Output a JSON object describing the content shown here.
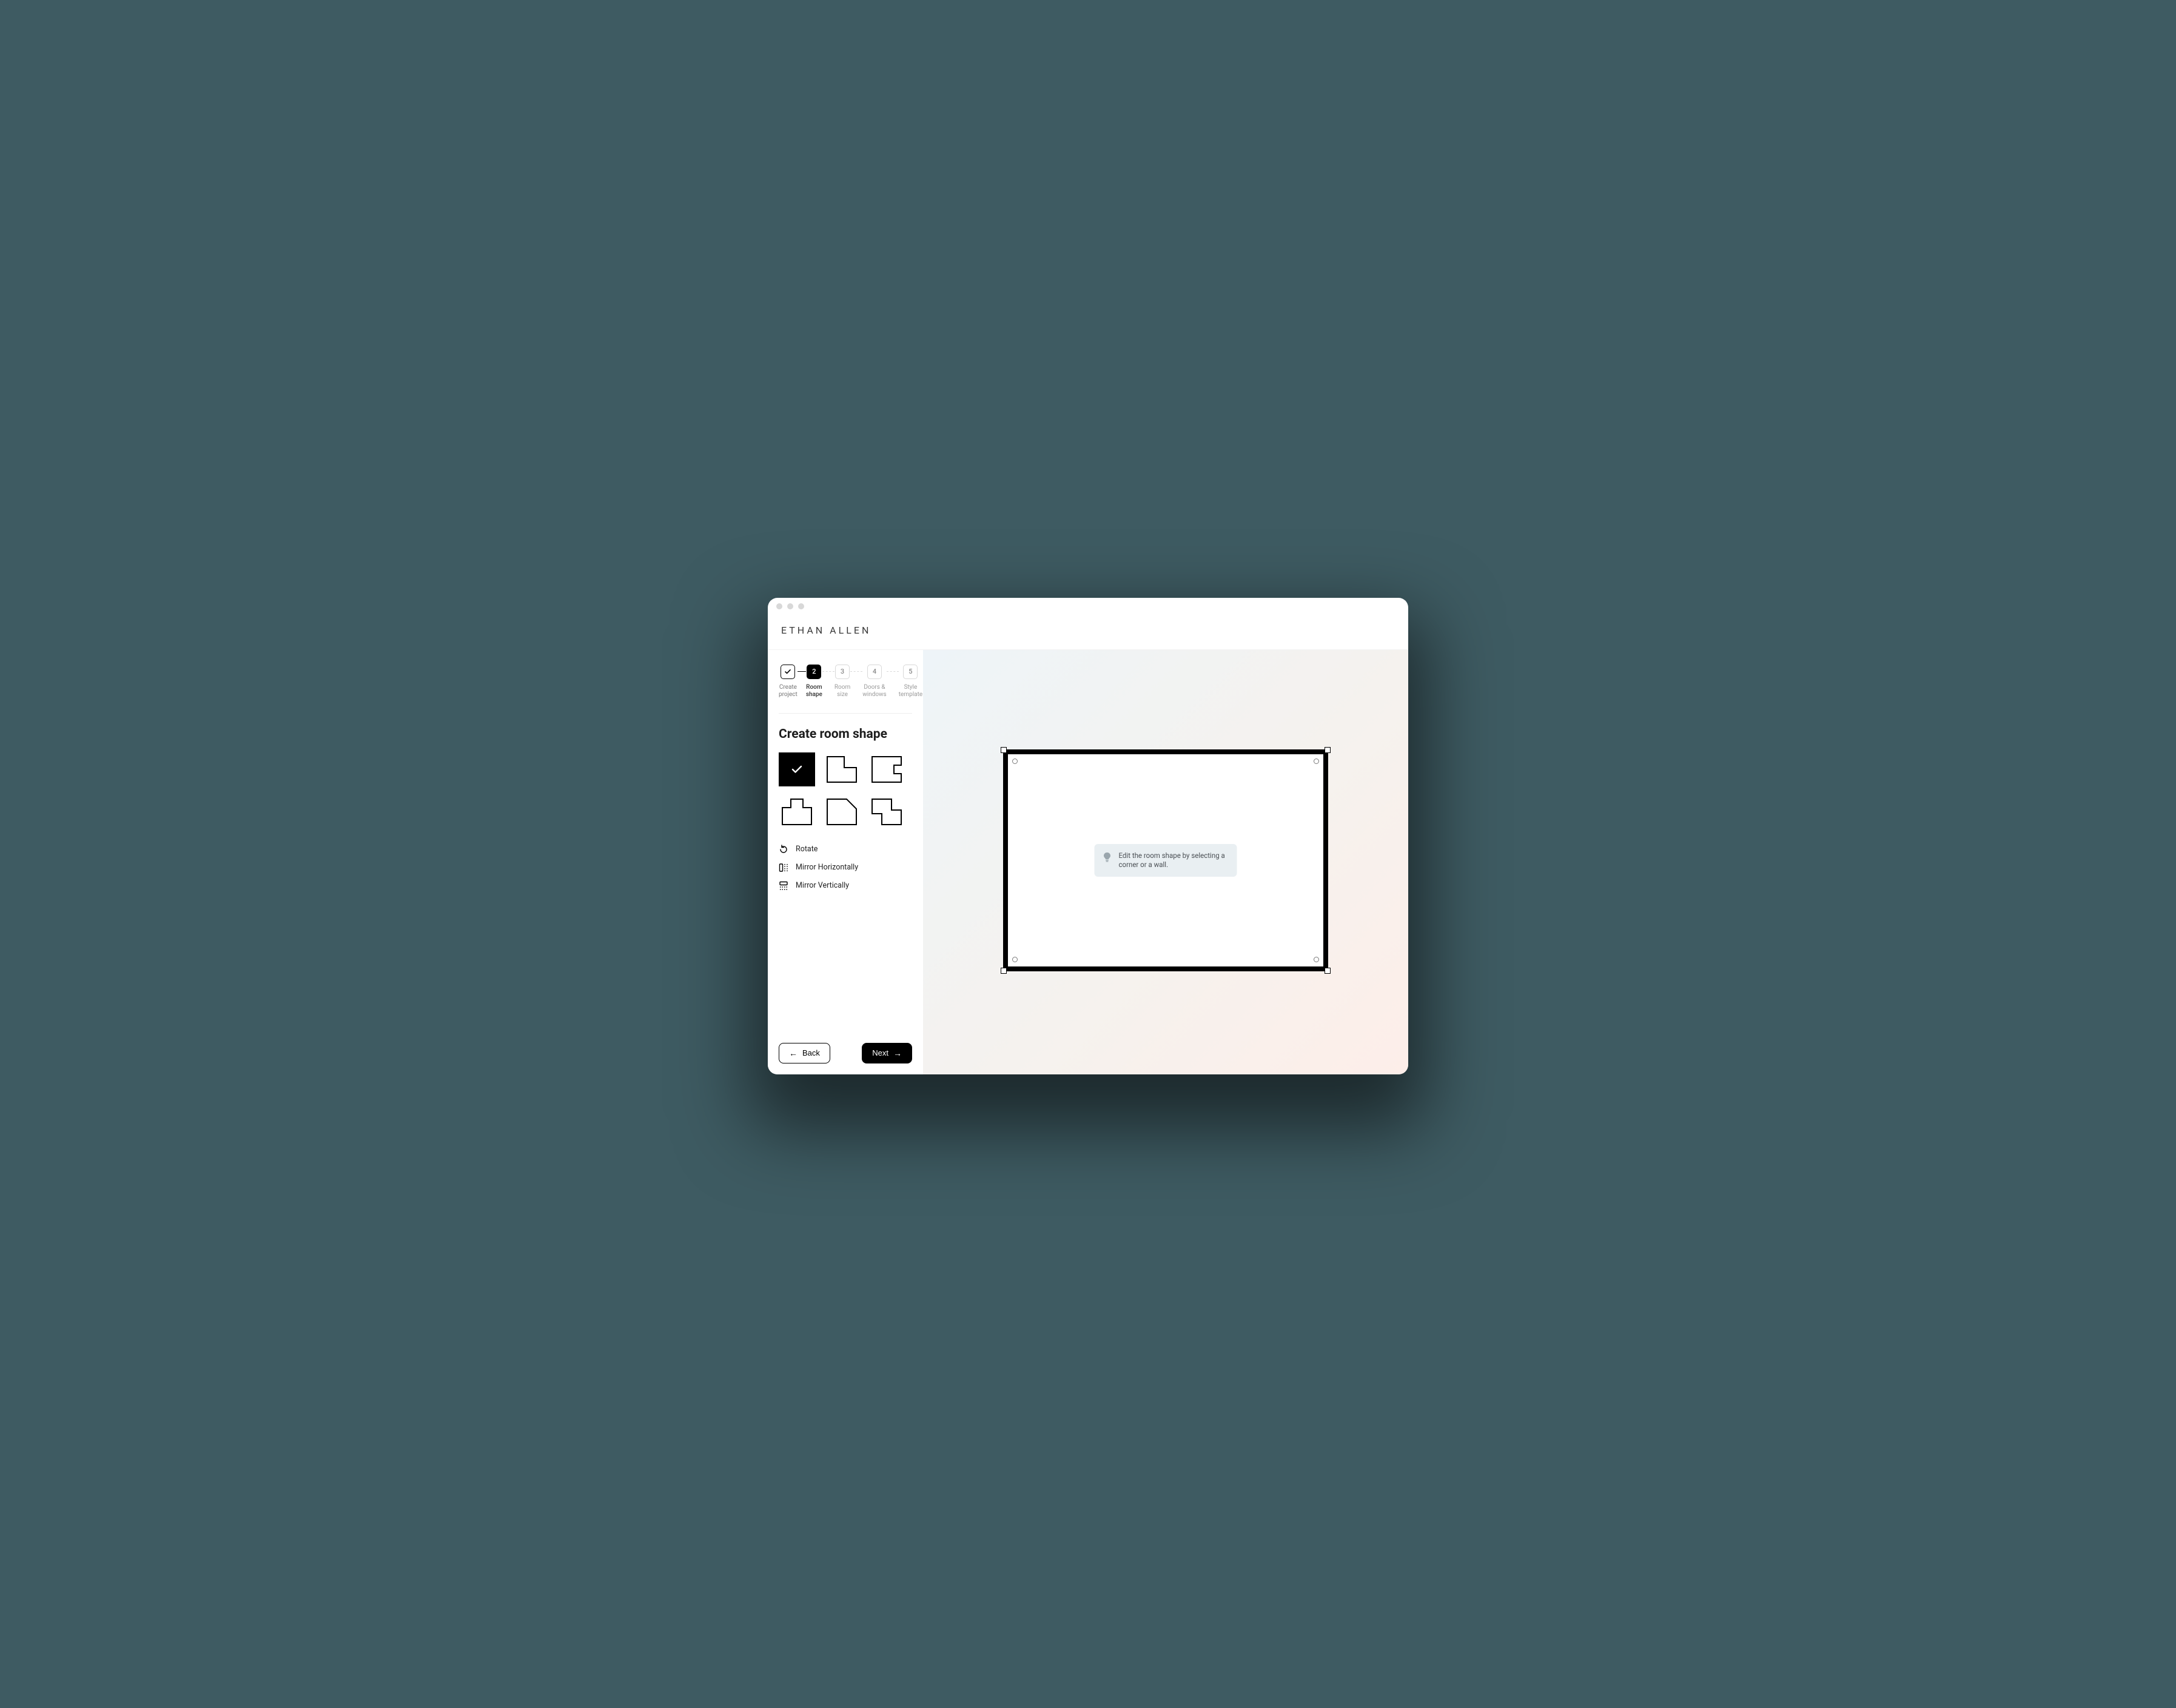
{
  "brand": "ETHAN ALLEN",
  "stepper": {
    "steps": [
      {
        "label": "Create\nproject",
        "state": "done",
        "value": "✓"
      },
      {
        "label": "Room\nshape",
        "state": "current",
        "value": "2"
      },
      {
        "label": "Room\nsize",
        "state": "future",
        "value": "3"
      },
      {
        "label": "Doors &\nwindows",
        "state": "future",
        "value": "4"
      },
      {
        "label": "Style\ntemplate",
        "state": "future",
        "value": "5"
      }
    ]
  },
  "section_title": "Create room shape",
  "shapes": {
    "selected_index": 0,
    "items": [
      "rectangle",
      "l-shape",
      "u-notch",
      "t-notch",
      "cut-corner",
      "z-shape"
    ]
  },
  "tools": {
    "rotate": "Rotate",
    "mirror_h": "Mirror Horizontally",
    "mirror_v": "Mirror Vertically"
  },
  "footer": {
    "back": "Back",
    "next": "Next"
  },
  "hint": {
    "text": "Edit the room shape by selecting a corner or a wall."
  }
}
